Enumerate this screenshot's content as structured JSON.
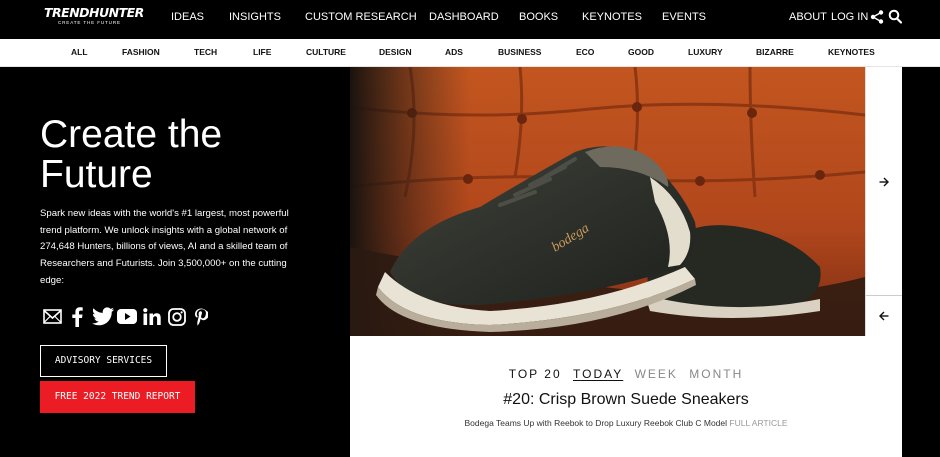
{
  "nav": {
    "logo_main": "TRENDHUNTER",
    "logo_tagline": "CREATE THE FUTURE",
    "links": [
      "IDEAS",
      "INSIGHTS",
      "CUSTOM RESEARCH",
      "DASHBOARD",
      "BOOKS",
      "KEYNOTES",
      "EVENTS"
    ],
    "about": "ABOUT",
    "login": "LOG IN",
    "icons": [
      "share-icon",
      "search-icon"
    ]
  },
  "categories": [
    "ALL",
    "FASHION",
    "TECH",
    "LIFE",
    "CULTURE",
    "DESIGN",
    "ADS",
    "BUSINESS",
    "ECO",
    "GOOD",
    "LUXURY",
    "BIZARRE",
    "KEYNOTES"
  ],
  "hero": {
    "title_line1": "Create the",
    "title_line2": "Future",
    "description": "Spark new ideas with the world's #1 largest, most powerful trend platform. We unlock insights with a global network of 274,648 Hunters, billions of views, AI and a skilled team of Researchers and Futurists. Join 3,500,000+ on the cutting edge:",
    "social_icons": [
      "email-icon",
      "facebook-icon",
      "twitter-icon",
      "youtube-icon",
      "linkedin-icon",
      "instagram-icon",
      "pinterest-icon"
    ],
    "advisory_button": "ADVISORY SERVICES",
    "report_button": "FREE 2022 TREND REPORT"
  },
  "feature": {
    "image": "bodega-reebok-suede-sneakers-photo",
    "tabs": {
      "label": "TOP 20",
      "today": "TODAY",
      "week": "WEEK",
      "month": "MONTH"
    },
    "title": "#20: Crisp Brown Suede Sneakers",
    "subtitle": "Bodega Teams Up with Reebok to Drop Luxury Reebok Club C Model",
    "full_article": "FULL ARTICLE"
  },
  "colors": {
    "background": "#000000",
    "accent_red": "#ec1c24",
    "chair_orange": "#b84b22",
    "text_white": "#ffffff"
  }
}
